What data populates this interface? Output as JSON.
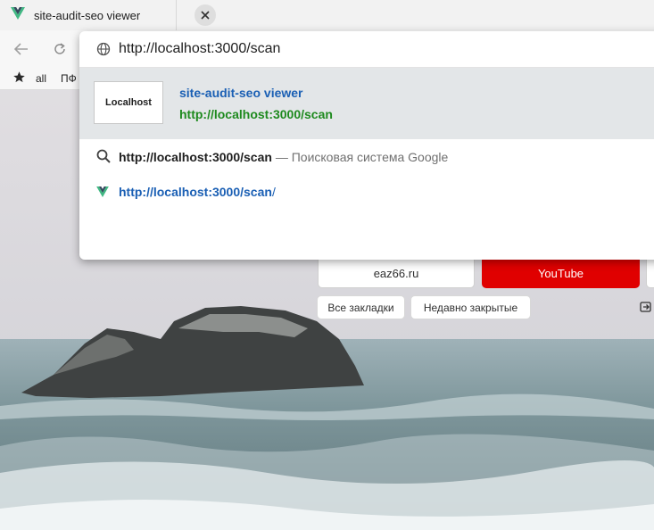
{
  "tab": {
    "title": "site-audit-seo viewer"
  },
  "omnibox": {
    "value": "http://localhost:3000/scan",
    "suggestions": {
      "selected": {
        "logo_text": "Localhost",
        "title": "site-audit-seo viewer",
        "url": "http://localhost:3000/scan"
      },
      "search": {
        "query": "http://localhost:3000/scan",
        "suffix": " — Поисковая система Google"
      },
      "link": {
        "url": "http://localhost:3000/scan",
        "trailing": "/"
      }
    }
  },
  "bookmarks": {
    "items": [
      {
        "label": "all"
      },
      {
        "label": "ПФ"
      }
    ]
  },
  "new_tab": {
    "tiles": [
      {
        "label": "eaz66.ru"
      },
      {
        "label": "YouTube"
      }
    ],
    "buttons": {
      "bookmarks_label": "Все закладки",
      "recently_closed_label": "Недавно закрытые"
    }
  },
  "colors": {
    "accent_link": "#1a5fb4",
    "url_green": "#1e8a1e",
    "youtube_red": "#e00000"
  },
  "icons": [
    "vue-logo-icon",
    "close-icon",
    "back-icon",
    "reload-icon",
    "star-icon",
    "globe-icon",
    "search-icon",
    "import-icon"
  ]
}
